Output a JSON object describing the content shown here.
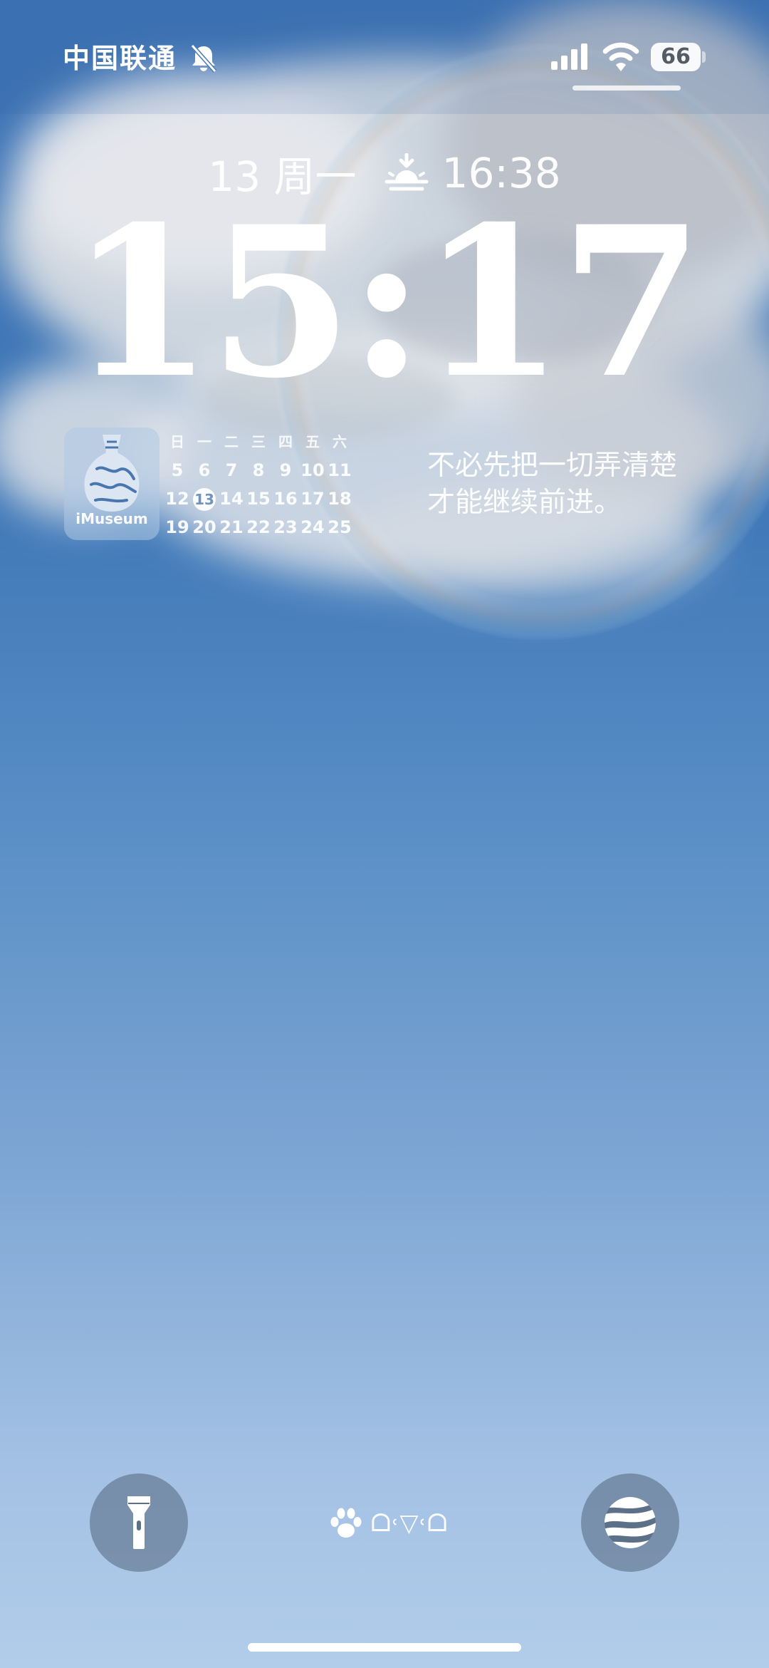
{
  "status_bar": {
    "carrier": "中国联通",
    "battery_level": "66",
    "icons": [
      "bell-slash-icon",
      "cellular-signal-icon",
      "wifi-icon",
      "battery-icon"
    ]
  },
  "lock_screen": {
    "date": "13 周一",
    "sunset_icon": "sunset-icon",
    "sunset_time": "16:38",
    "time": "15:17"
  },
  "widgets": {
    "museum": {
      "label": "iMuseum",
      "icon": "blue-white-vase-icon"
    },
    "calendar": {
      "weekday_headers": [
        "日",
        "一",
        "二",
        "三",
        "四",
        "五",
        "六"
      ],
      "weeks": [
        [
          "5",
          "6",
          "7",
          "8",
          "9",
          "10",
          "11"
        ],
        [
          "12",
          "13",
          "14",
          "15",
          "16",
          "17",
          "18"
        ],
        [
          "19",
          "20",
          "21",
          "22",
          "23",
          "24",
          "25"
        ]
      ],
      "today": "13"
    },
    "quote": {
      "line1": "不必先把一切弄清楚",
      "line2": "才能继续前进。"
    }
  },
  "bottom": {
    "left_button_icon": "flashlight-icon",
    "right_button_icon": "zebra-stripe-icon",
    "paw_icon": "paw-icon",
    "kaomoji": "ᗝ˓▽˓ᗝ"
  },
  "colors": {
    "sky_top": "#3d72b4",
    "sky_bottom": "#b2cdea",
    "button_bg": "#5c7088",
    "today_text": "#6f93bd"
  }
}
